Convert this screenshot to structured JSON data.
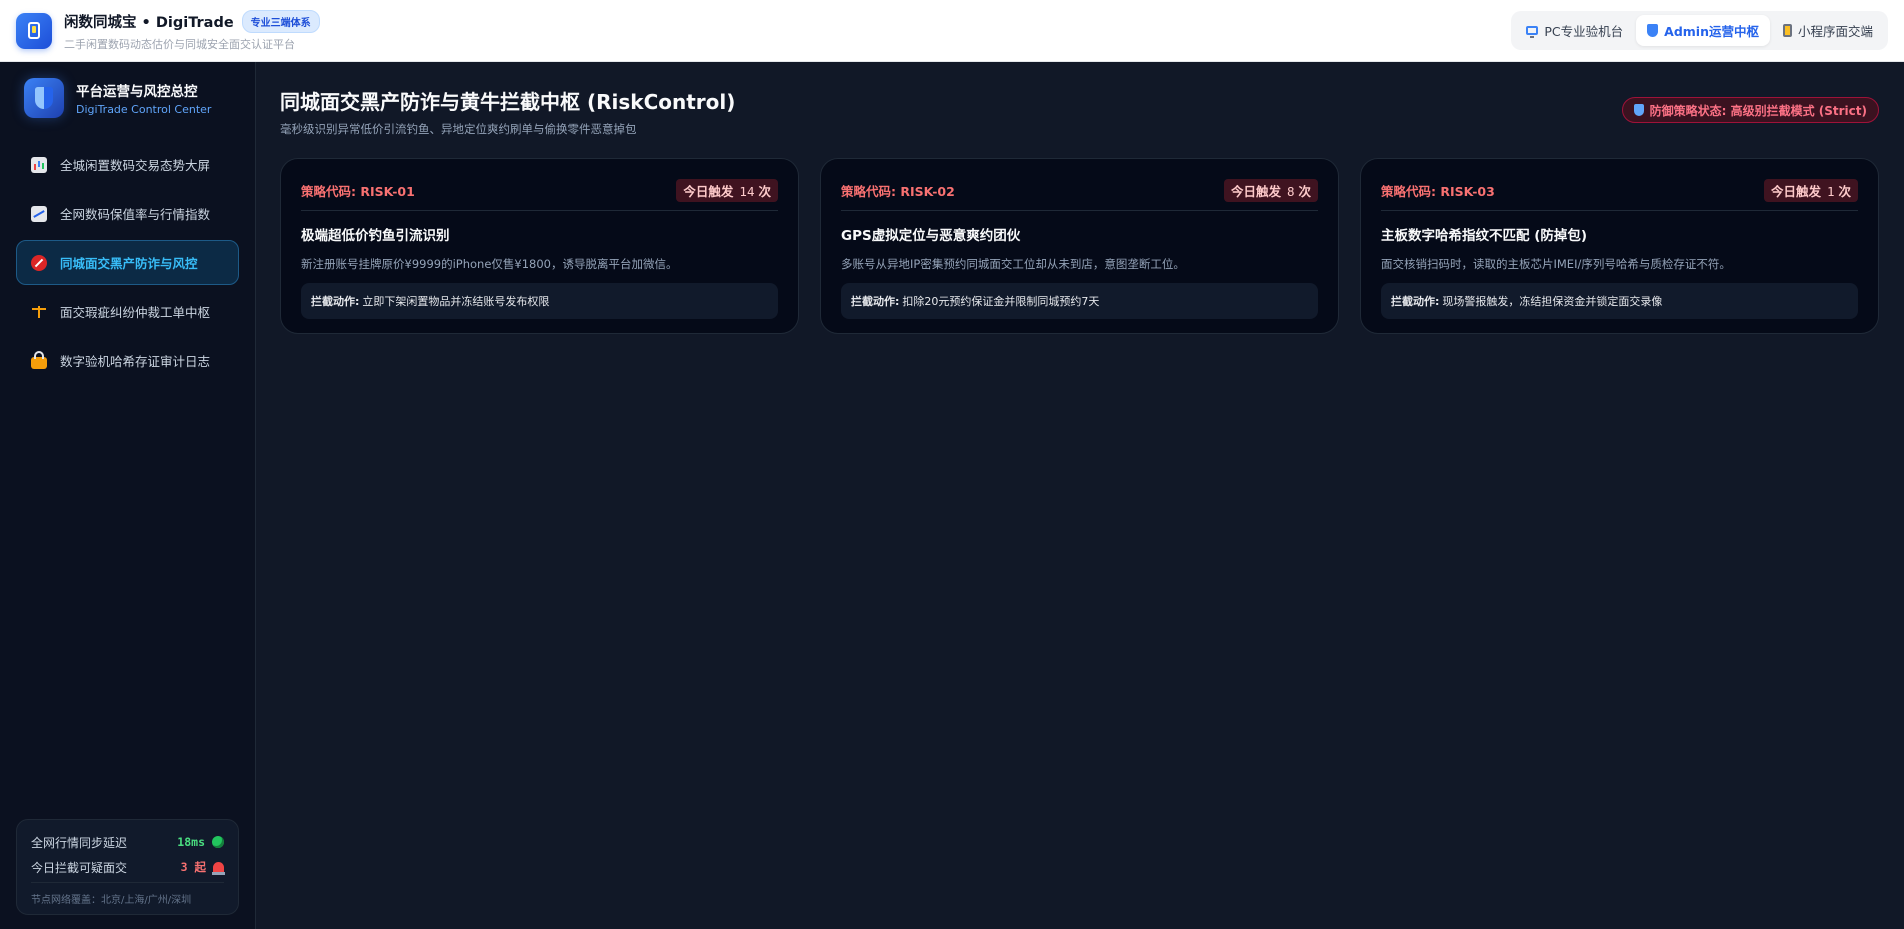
{
  "header": {
    "title": "闲数同城宝 • DigiTrade",
    "badge": "专业三端体系",
    "subtitle": "二手闲置数码动态估价与同城安全面交认证平台",
    "tabs": [
      {
        "label": "PC专业验机台",
        "icon": "desktop-icon",
        "active": false
      },
      {
        "label": "Admin运营中枢",
        "icon": "shield-icon",
        "active": true
      },
      {
        "label": "小程序面交端",
        "icon": "mobile-icon",
        "active": false
      }
    ]
  },
  "sidebar": {
    "title": "平台运营与风控总控",
    "subtitle": "DigiTrade Control Center",
    "items": [
      {
        "label": "全城闲置数码交易态势大屏",
        "icon": "bar-chart-icon",
        "active": false
      },
      {
        "label": "全网数码保值率与行情指数",
        "icon": "trend-chart-icon",
        "active": false
      },
      {
        "label": "同城面交黑产防诈与风控",
        "icon": "prohibited-icon",
        "active": true
      },
      {
        "label": "面交瑕疵纠纷仲裁工单中枢",
        "icon": "scales-icon",
        "active": false
      },
      {
        "label": "数字验机哈希存证审计日志",
        "icon": "lock-icon",
        "active": false
      }
    ],
    "status": {
      "sync_label": "全网行情同步延迟",
      "sync_value": "18ms",
      "intercept_label": "今日拦截可疑面交",
      "intercept_value": "3 起",
      "nodes": "节点网络覆盖：北京/上海/广州/深圳"
    }
  },
  "main": {
    "title": "同城面交黑产防诈与黄牛拦截中枢 (RiskControl)",
    "subtitle": "毫秒级识别异常低价引流钓鱼、异地定位爽约刷单与偷换零件恶意掉包",
    "mode": "防御策略状态: 高级别拦截模式 (Strict)",
    "cards": [
      {
        "code": "策略代码: RISK-01",
        "trigger_prefix": "今日触发",
        "trigger_count": "14",
        "trigger_unit": "次",
        "title": "极端超低价钓鱼引流识别",
        "desc": "新注册账号挂牌原价¥9999的iPhone仅售¥1800，诱导脱离平台加微信。",
        "action_label": "拦截动作:",
        "action": "立即下架闲置物品并冻结账号发布权限"
      },
      {
        "code": "策略代码: RISK-02",
        "trigger_prefix": "今日触发",
        "trigger_count": "8",
        "trigger_unit": "次",
        "title": "GPS虚拟定位与恶意爽约团伙",
        "desc": "多账号从异地IP密集预约同城面交工位却从未到店，意图垄断工位。",
        "action_label": "拦截动作:",
        "action": "扣除20元预约保证金并限制同城预约7天"
      },
      {
        "code": "策略代码: RISK-03",
        "trigger_prefix": "今日触发",
        "trigger_count": "1",
        "trigger_unit": "次",
        "title": "主板数字哈希指纹不匹配 (防掉包)",
        "desc": "面交核销扫码时，读取的主板芯片IMEI/序列号哈希与质检存证不符。",
        "action_label": "拦截动作:",
        "action": "现场警报触发，冻结担保资金并锁定面交录像"
      }
    ]
  },
  "colors": {
    "accent": "#2563eb",
    "danger": "#f87171",
    "success": "#4ade80",
    "background": "#111827"
  }
}
